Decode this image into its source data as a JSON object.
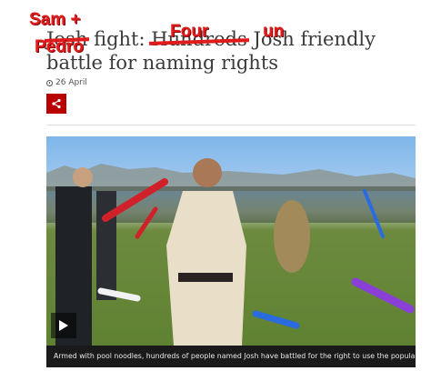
{
  "headline": {
    "struck_word_1": "Josh",
    "word_2": "fight:",
    "struck_word_3": "Hundreds",
    "rest_line_1": "Josh friendly",
    "line_2": "battle for naming rights"
  },
  "overlays": {
    "sam": "Sam +",
    "pedro": "Pedro",
    "four": "Four",
    "un": "un"
  },
  "date": "26 April",
  "share_label": "Share",
  "media": {
    "caption": "Armed with pool noodles, hundreds of people named Josh have battled for the right to use the popular name.",
    "play_label": "Play video"
  },
  "colors": {
    "accent_red": "#b80000",
    "scribble_red": "#e01b1b"
  }
}
